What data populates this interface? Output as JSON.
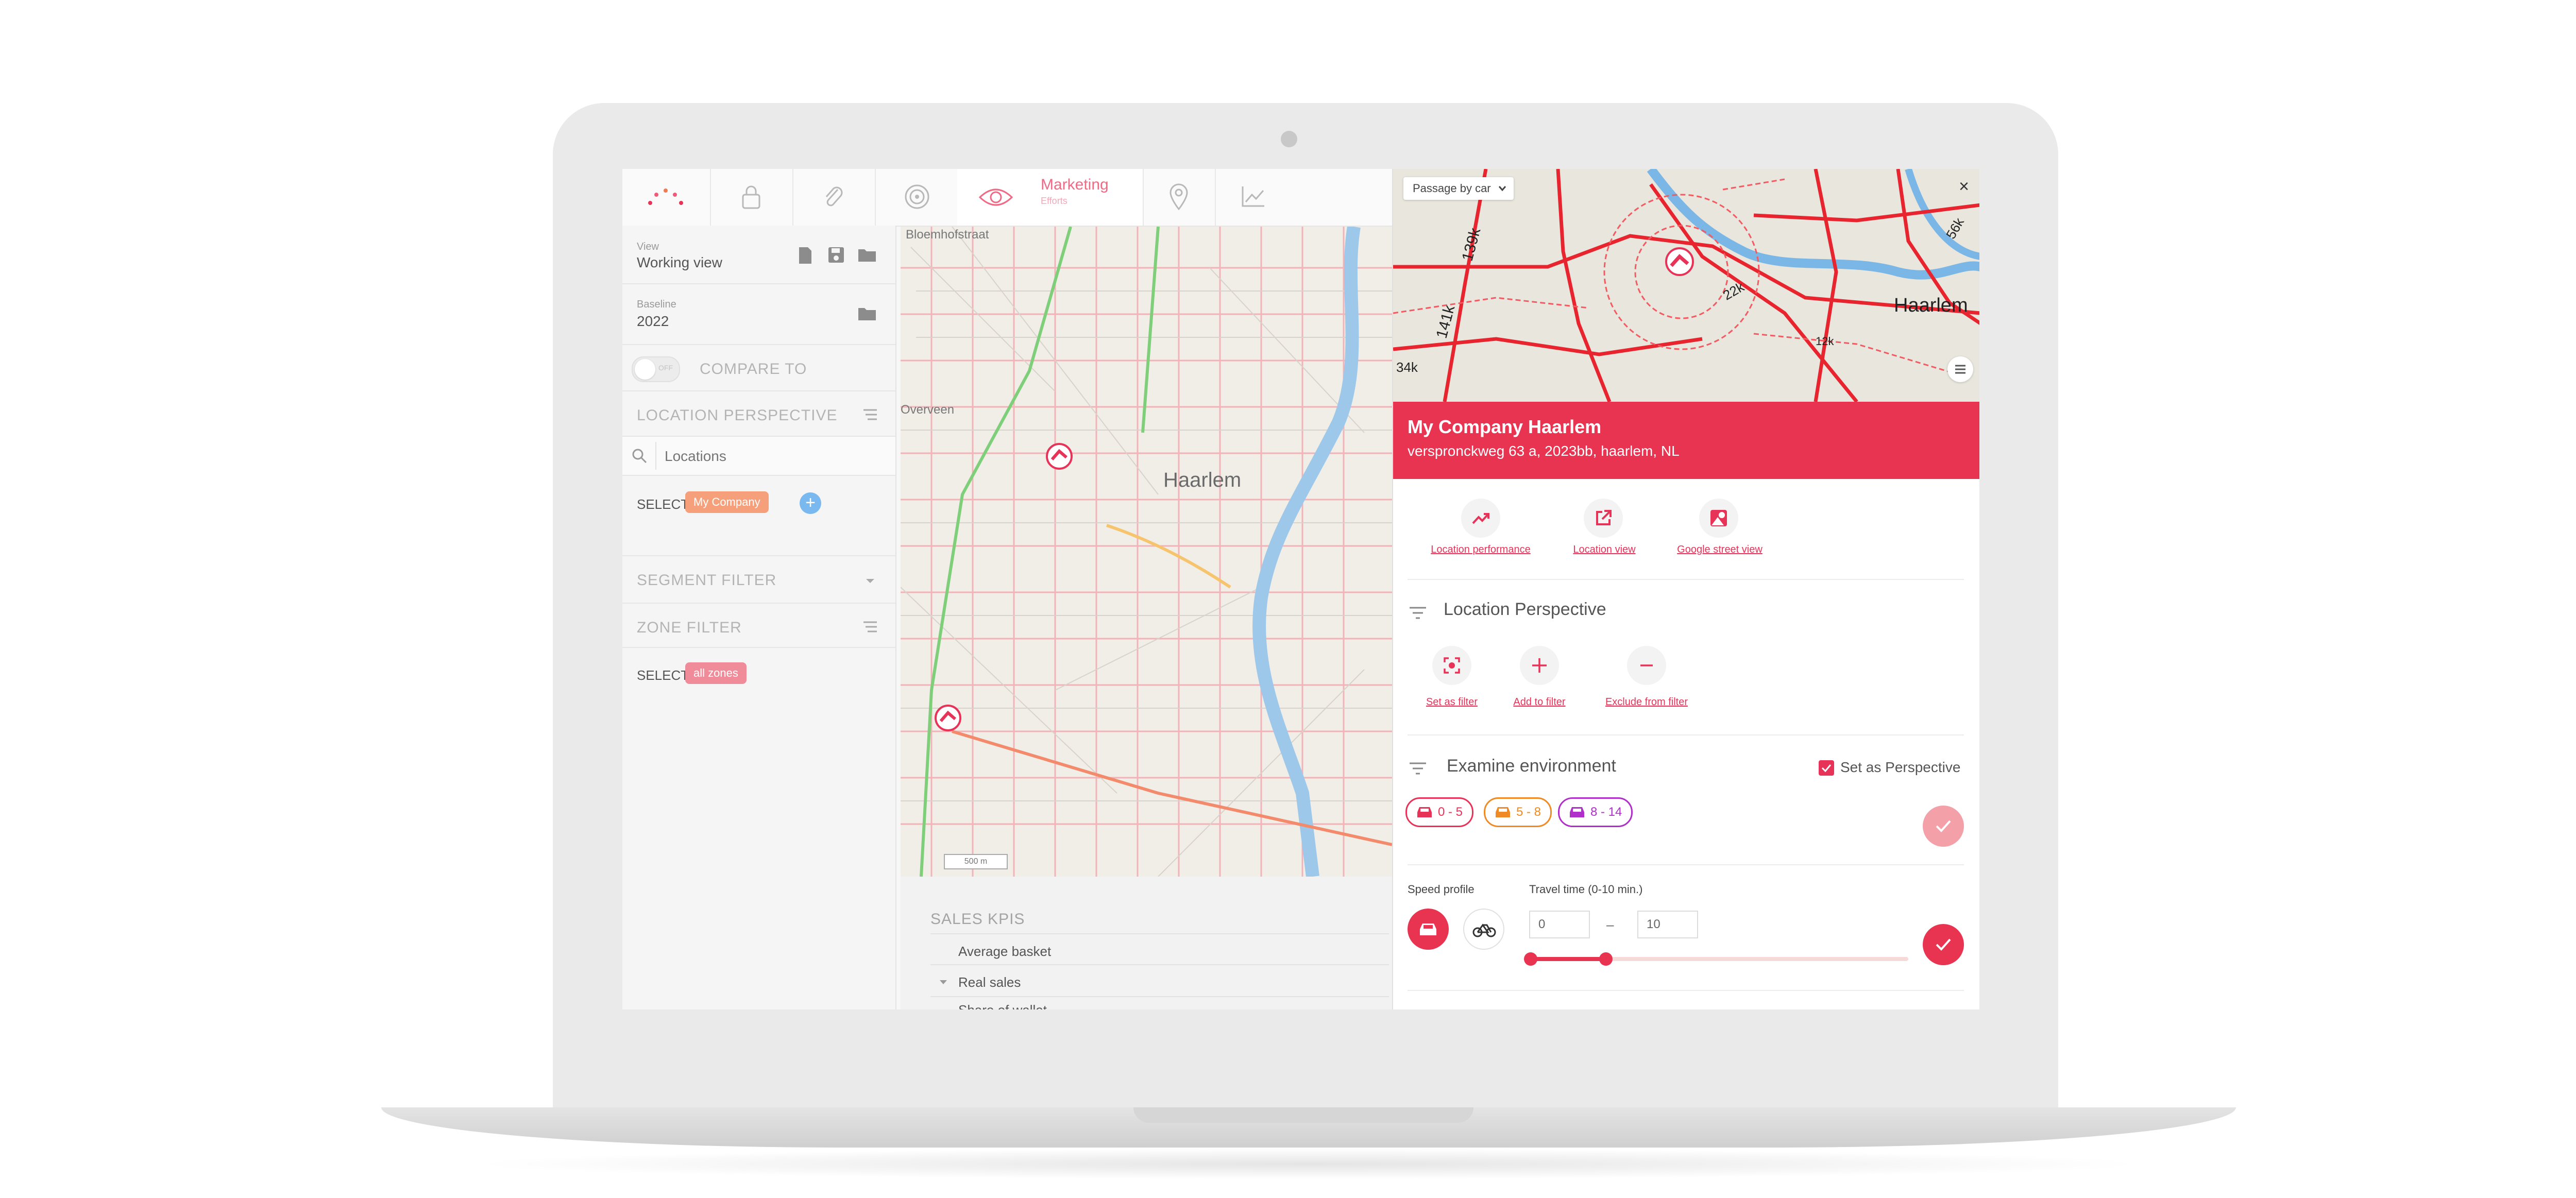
{
  "nav": {
    "active_label": "Marketing",
    "active_sublabel": "Efforts",
    "icons": [
      "logo-dots-icon",
      "lock-icon",
      "paperclip-icon",
      "target-icon",
      "eye-icon",
      "location-pin-icon",
      "trend-chart-icon"
    ]
  },
  "sidebar": {
    "view_label": "View",
    "view_value": "Working view",
    "baseline_label": "Baseline",
    "baseline_value": "2022",
    "toggle_text": "OFF",
    "compare_to": "COMPARE TO",
    "location_perspective": "LOCATION PERSPECTIVE",
    "search_placeholder": "Locations",
    "select_label": "SELECT",
    "selected_location_chip": "My Company",
    "segment_filter": "SEGMENT FILTER",
    "zone_filter": "ZONE FILTER",
    "zone_select_label": "SELECT",
    "zone_chip": "all zones"
  },
  "map": {
    "city_label": "Haarlem",
    "street_label": "Bloemhofstraat",
    "edge_label": "Overveen",
    "scale_label": "500 m"
  },
  "kpis": {
    "header": "SALES KPIS",
    "rows": [
      "Average basket",
      "Real sales",
      "Share of wallet"
    ]
  },
  "panel": {
    "mode_dropdown": "Passage by car",
    "traffic_labels": [
      "139k",
      "141k",
      "34k",
      "22k",
      "56k",
      "12k"
    ],
    "map_city_label": "Haarlem",
    "title": "My Company Haarlem",
    "address": "verspronckweg 63 a, 2023bb, haarlem, NL",
    "actions": [
      "Location performance",
      "Location view",
      "Google street view"
    ],
    "location_perspective_title": "Location Perspective",
    "filter_actions": [
      "Set as filter",
      "Add to filter",
      "Exclude from filter"
    ],
    "examine_title": "Examine environment",
    "set_as_perspective": "Set as Perspective",
    "time_pills": [
      {
        "label": "0 - 5",
        "color": "#e83359"
      },
      {
        "label": "5 - 8",
        "color": "#f08a24"
      },
      {
        "label": "8 - 14",
        "color": "#b02ec9"
      }
    ],
    "speed_profile_label": "Speed profile",
    "travel_time_label": "Travel time (0-10 min.)",
    "travel_from": "0",
    "travel_to": "10",
    "travel_range": [
      0,
      10
    ]
  },
  "colors": {
    "accent": "#e83359",
    "accent_light": "#f5a6b5",
    "location_chip": "#f5a07b",
    "zone_chip": "#f08c9a",
    "add_button": "#7ab8f0"
  }
}
